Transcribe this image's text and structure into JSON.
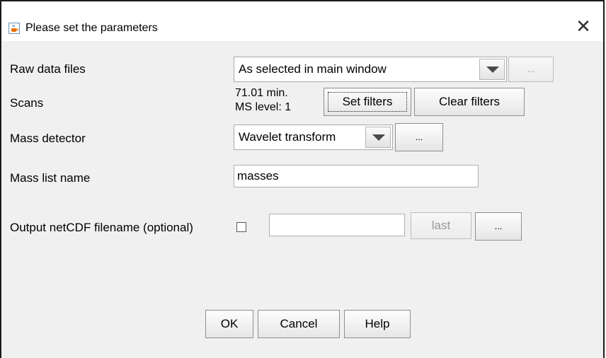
{
  "window": {
    "title": "Please set the parameters",
    "close_label": "✕"
  },
  "raw_data_files": {
    "label": "Raw data files",
    "selected": "As selected in main window",
    "browse_label": "..."
  },
  "scans": {
    "label": "Scans",
    "info_line1": "71.01 min.",
    "info_line2": "MS level: 1",
    "set_filters_label": "Set filters",
    "clear_filters_label": "Clear filters"
  },
  "mass_detector": {
    "label": "Mass detector",
    "selected": "Wavelet transform",
    "setup_label": "..."
  },
  "mass_list_name": {
    "label": "Mass list name",
    "value": "masses"
  },
  "output_netcdf": {
    "label": "Output netCDF filename (optional)",
    "checked": false,
    "value": "",
    "last_label": "last",
    "browse_label": "..."
  },
  "footer": {
    "ok_label": "OK",
    "cancel_label": "Cancel",
    "help_label": "Help"
  }
}
